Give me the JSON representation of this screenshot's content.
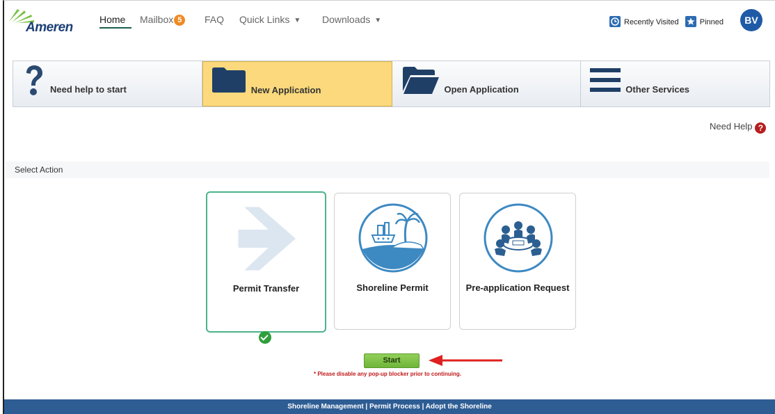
{
  "brand": {
    "name": "Ameren",
    "green": "#7bc043",
    "blue": "#1c3f75"
  },
  "nav": {
    "home": "Home",
    "mailbox": "Mailbox",
    "mailbox_count": "5",
    "faq": "FAQ",
    "quick_links": "Quick Links",
    "downloads": "Downloads",
    "recently_visited": "Recently Visited",
    "pinned": "Pinned",
    "avatar_initials": "BV"
  },
  "tiles": [
    {
      "label": "Need help to start",
      "icon": "question-icon"
    },
    {
      "label": "New Application",
      "icon": "folder-icon",
      "active": true
    },
    {
      "label": "Open Application",
      "icon": "folder-open-icon"
    },
    {
      "label": "Other Services",
      "icon": "menu-icon"
    }
  ],
  "need_help": "Need Help",
  "section_title": "Select Action",
  "actions": [
    {
      "label": "Permit Transfer",
      "icon": "arrow-right-icon",
      "selected": true
    },
    {
      "label": "Shoreline Permit",
      "icon": "island-boat-icon"
    },
    {
      "label": "Pre-application Request",
      "icon": "meeting-icon"
    }
  ],
  "start_button": "Start",
  "popup_note": "* Please disable any pop-up blocker prior to continuing.",
  "footer": "Shoreline Management | Permit Process | Adopt the Shoreline"
}
